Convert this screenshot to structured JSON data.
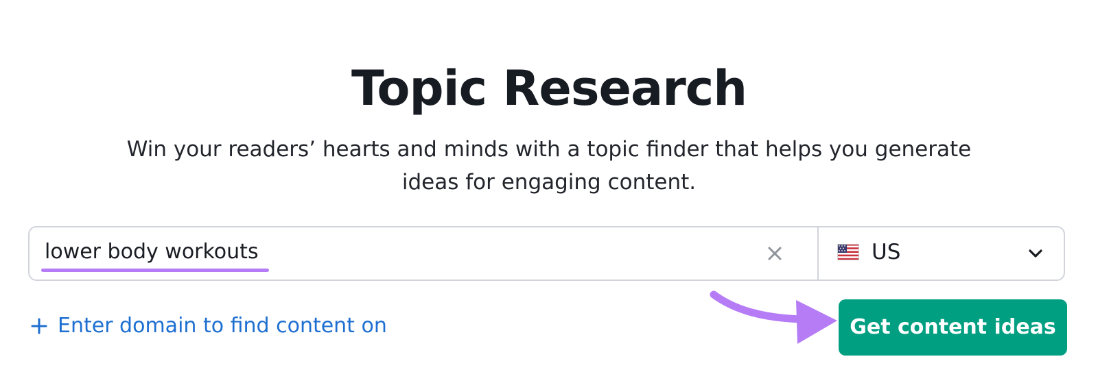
{
  "header": {
    "title": "Topic Research",
    "subtitle": "Win your readers’ hearts and minds with a topic finder that helps you generate ideas for engaging content."
  },
  "search": {
    "query_value": "lower body workouts",
    "clear_icon": "close-icon",
    "country": {
      "flag_icon": "us-flag-icon",
      "selected": "US",
      "toggle_icon": "chevron-down-icon"
    }
  },
  "domain_link": {
    "icon": "plus-icon",
    "label": "Enter domain to find content on"
  },
  "cta": {
    "label": "Get content ideas"
  },
  "annotation": {
    "arrow_icon": "arrow-annotation",
    "underline_color": "#b57cf6",
    "arrow_color": "#b57cf6"
  },
  "colors": {
    "button_bg": "#009f81",
    "link": "#1e6fd1",
    "title": "#171b22",
    "border": "#d1d4db"
  }
}
